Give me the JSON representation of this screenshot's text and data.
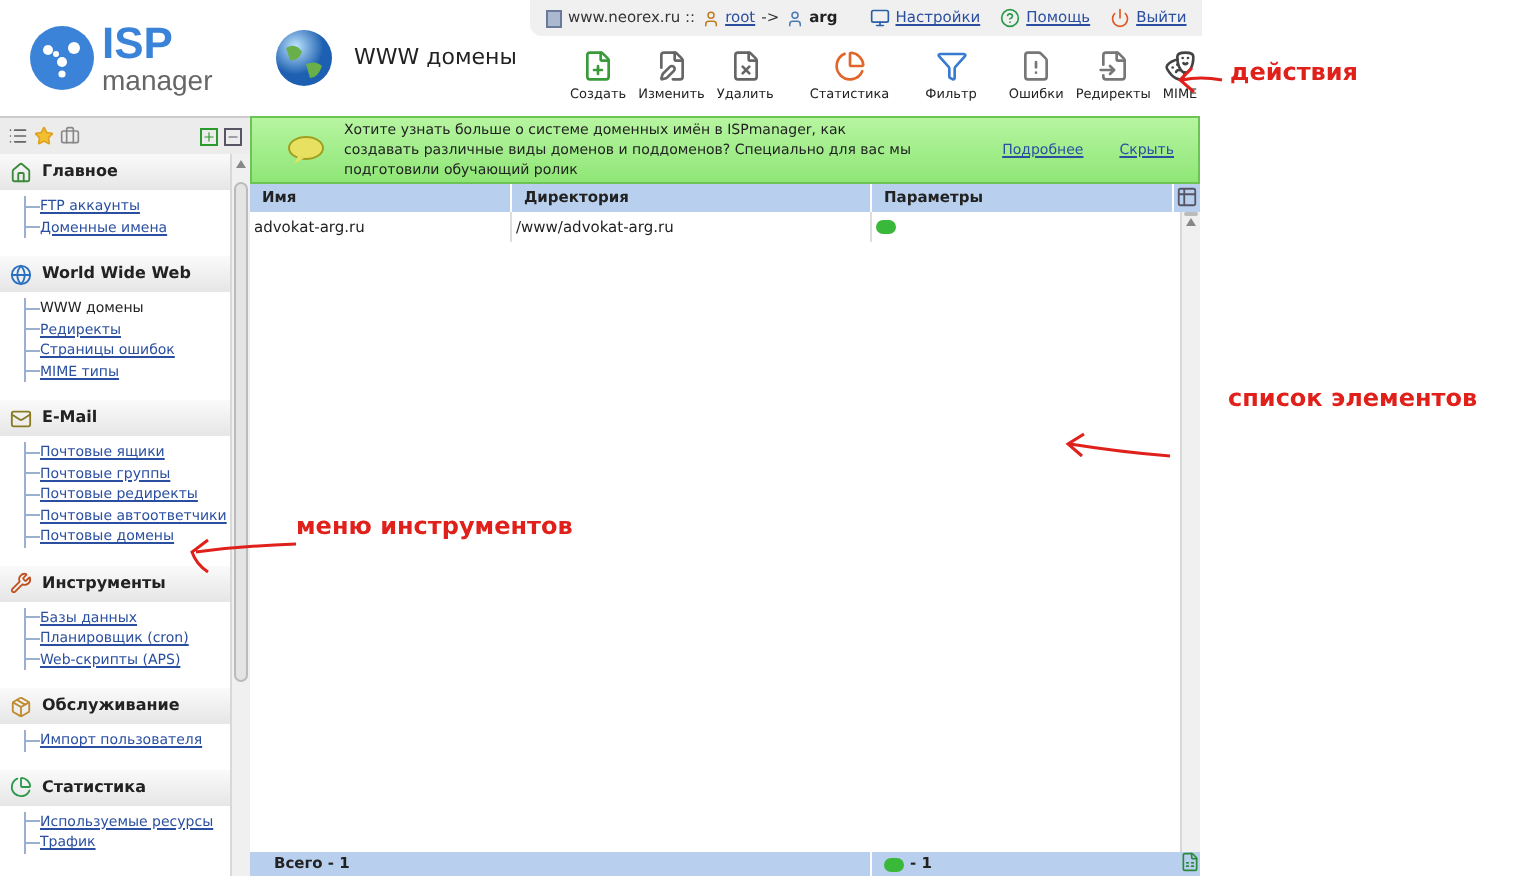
{
  "logo": {
    "line_1": "ISP",
    "line_2": "manager"
  },
  "page_title": "WWW домены",
  "session": {
    "host": "www.neorex.ru ::",
    "user": "root",
    "arrow": "->",
    "account": "arg"
  },
  "top_links": [
    {
      "label": "Настройки",
      "kind": "settings"
    },
    {
      "label": "Помощь",
      "kind": "help"
    },
    {
      "label": "Выйти",
      "kind": "logout"
    }
  ],
  "toolbar": [
    {
      "label": "Создать",
      "kind": "create"
    },
    {
      "label": "Изменить",
      "kind": "edit"
    },
    {
      "label": "Удалить",
      "kind": "delete"
    },
    {
      "label": "Статистика",
      "kind": "stats"
    },
    {
      "label": "Фильтр",
      "kind": "filter"
    },
    {
      "label": "Ошибки",
      "kind": "errors"
    },
    {
      "label": "Редиректы",
      "kind": "redirects"
    },
    {
      "label": "MIME",
      "kind": "mime"
    }
  ],
  "sidebar": {
    "sections": [
      {
        "title": "Главное",
        "kind": "main",
        "items": [
          {
            "label": "FTP аккаунты",
            "selected": false
          },
          {
            "label": "Доменные имена",
            "selected": false
          }
        ]
      },
      {
        "title": "World Wide Web",
        "kind": "web",
        "items": [
          {
            "label": "WWW домены",
            "selected": true
          },
          {
            "label": "Редиректы",
            "selected": false
          },
          {
            "label": "Страницы ошибок",
            "selected": false
          },
          {
            "label": "MIME типы",
            "selected": false
          }
        ]
      },
      {
        "title": "E-Mail",
        "kind": "mail",
        "items": [
          {
            "label": "Почтовые ящики",
            "selected": false
          },
          {
            "label": "Почтовые группы",
            "selected": false
          },
          {
            "label": "Почтовые редиректы",
            "selected": false
          },
          {
            "label": "Почтовые автоответчики",
            "selected": false
          },
          {
            "label": "Почтовые домены",
            "selected": false
          }
        ]
      },
      {
        "title": "Инструменты",
        "kind": "tools",
        "items": [
          {
            "label": "Базы данных",
            "selected": false
          },
          {
            "label": "Планировщик (cron)",
            "selected": false
          },
          {
            "label": "Web-скрипты (APS)",
            "selected": false
          }
        ]
      },
      {
        "title": "Обслуживание",
        "kind": "service",
        "items": [
          {
            "label": "Импорт пользователя",
            "selected": false
          }
        ]
      },
      {
        "title": "Статистика",
        "kind": "stats",
        "items": [
          {
            "label": "Используемые ресурсы",
            "selected": false
          },
          {
            "label": "Трафик",
            "selected": false
          }
        ]
      }
    ]
  },
  "banner": {
    "text": "Хотите узнать больше о системе доменных имён в ISPmanager, как создавать различные виды доменов и поддоменов? Специально для вас мы подготовили обучающий ролик",
    "links": [
      "Подробнее",
      "Скрыть"
    ]
  },
  "table": {
    "columns": [
      "Имя",
      "Директория",
      "Параметры"
    ],
    "rows": [
      {
        "name": "advokat-arg.ru",
        "directory": "/www/advokat-arg.ru"
      }
    ],
    "footer": {
      "total": "Всего - 1",
      "count": "- 1"
    }
  },
  "annotations": [
    "действия",
    "список элементов",
    "меню инструментов"
  ]
}
